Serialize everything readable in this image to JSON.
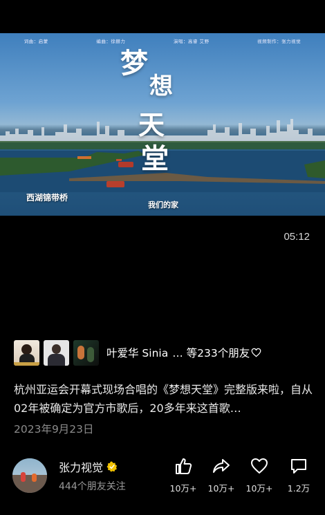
{
  "video": {
    "credits": [
      "词曲：启蒙",
      "编曲：徐赫力",
      "演唱：高睿 艾野",
      "视频制作：张力视觉"
    ],
    "title_chars": [
      "梦",
      "想",
      "天",
      "堂"
    ],
    "caption_left": "西湖锦带桥",
    "caption_center": "我们的家",
    "duration": "05:12"
  },
  "friends": {
    "names": "叶爱华 Sinia",
    "suffix": "… 等233个朋友"
  },
  "post": {
    "description": "杭州亚运会开幕式现场合唱的《梦想天堂》完整版来啦，自从02年被确定为官方市歌后，20多年来这首歌…",
    "date": "2023年9月23日"
  },
  "channel": {
    "name": "张力视觉",
    "followers": "444个朋友关注"
  },
  "actions": {
    "like_count": "10万+",
    "share_count": "10万+",
    "favorite_count": "10万+",
    "comment_count": "1.2万"
  },
  "colors": {
    "background": "#000000",
    "verified_badge": "#f2c200",
    "date_text": "#8b8b8b"
  }
}
